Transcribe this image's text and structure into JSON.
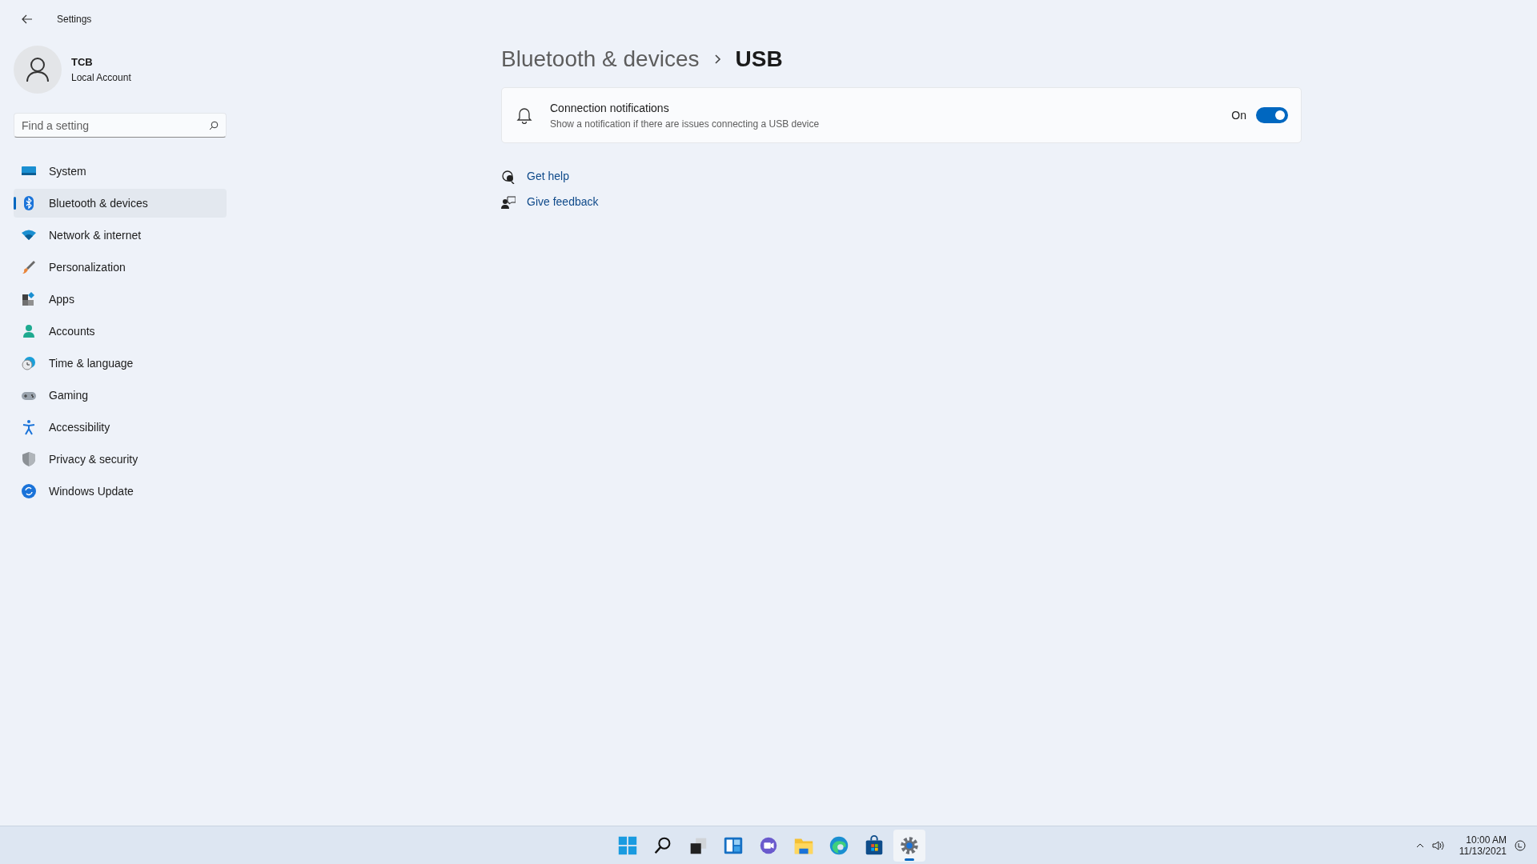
{
  "window": {
    "title": "Settings"
  },
  "account": {
    "name": "TCB",
    "type": "Local Account"
  },
  "search": {
    "placeholder": "Find a setting"
  },
  "nav": [
    {
      "label": "System",
      "selected": false
    },
    {
      "label": "Bluetooth & devices",
      "selected": true
    },
    {
      "label": "Network & internet",
      "selected": false
    },
    {
      "label": "Personalization",
      "selected": false
    },
    {
      "label": "Apps",
      "selected": false
    },
    {
      "label": "Accounts",
      "selected": false
    },
    {
      "label": "Time & language",
      "selected": false
    },
    {
      "label": "Gaming",
      "selected": false
    },
    {
      "label": "Accessibility",
      "selected": false
    },
    {
      "label": "Privacy & security",
      "selected": false
    },
    {
      "label": "Windows Update",
      "selected": false
    }
  ],
  "breadcrumb": {
    "parent": "Bluetooth & devices",
    "current": "USB"
  },
  "setting": {
    "title": "Connection notifications",
    "description": "Show a notification if there are issues connecting a USB device",
    "state_label": "On",
    "on": true
  },
  "links": [
    "Get help",
    "Give feedback"
  ],
  "taskbar": {
    "apps": [
      {
        "selected": false
      },
      {
        "selected": false
      },
      {
        "selected": false
      },
      {
        "selected": false
      },
      {
        "selected": false
      },
      {
        "selected": false
      },
      {
        "selected": false
      },
      {
        "selected": false
      },
      {
        "selected": true
      }
    ],
    "clock": {
      "time": "10:00 AM",
      "date": "11/13/2021"
    }
  }
}
